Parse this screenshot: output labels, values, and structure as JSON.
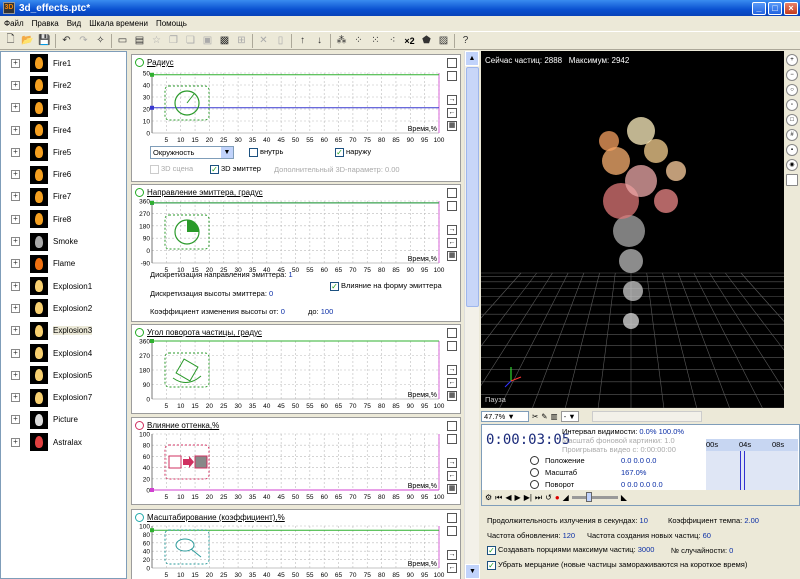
{
  "window": {
    "title": "3d_effects.ptc*"
  },
  "menu": [
    "Файл",
    "Правка",
    "Вид",
    "Шкала времени",
    "Помощь"
  ],
  "layers": [
    {
      "name": "Fire1",
      "icon": "fire-thumbnail-icon"
    },
    {
      "name": "Fire2",
      "icon": "fire-thumbnail-icon"
    },
    {
      "name": "Fire3",
      "icon": "fire-thumbnail-icon"
    },
    {
      "name": "Fire4",
      "icon": "fire-thumbnail-icon"
    },
    {
      "name": "Fire5",
      "icon": "fire-thumbnail-icon"
    },
    {
      "name": "Fire6",
      "icon": "fire-thumbnail-icon"
    },
    {
      "name": "Fire7",
      "icon": "fire-thumbnail-icon"
    },
    {
      "name": "Fire8",
      "icon": "fire-thumbnail-icon"
    },
    {
      "name": "Smoke",
      "icon": "smoke-thumbnail-icon"
    },
    {
      "name": "Flame",
      "icon": "flame-thumbnail-icon"
    },
    {
      "name": "Explosion1",
      "icon": "explosion-thumbnail-icon"
    },
    {
      "name": "Explosion2",
      "icon": "explosion-thumbnail-icon"
    },
    {
      "name": "Explosion3",
      "icon": "explosion-thumbnail-icon"
    },
    {
      "name": "Explosion4",
      "icon": "explosion-thumbnail-icon"
    },
    {
      "name": "Explosion5",
      "icon": "explosion-thumbnail-icon"
    },
    {
      "name": "Explosion7",
      "icon": "explosion-thumbnail-icon"
    },
    {
      "name": "Picture",
      "icon": "picture-thumbnail-icon"
    },
    {
      "name": "Astralax",
      "icon": "astralax-thumbnail-icon"
    }
  ],
  "selected_layer": "Explosion3",
  "xaxis_ticks": [
    "5",
    "10",
    "15",
    "20",
    "25",
    "30",
    "35",
    "40",
    "45",
    "50",
    "55",
    "60",
    "65",
    "70",
    "75",
    "80",
    "85",
    "90",
    "95",
    "100"
  ],
  "xaxis_label": "Время,%",
  "params": {
    "radius": {
      "title": "Радиус",
      "yticks": [
        "50",
        "40",
        "30",
        "20",
        "10",
        "0"
      ],
      "shape_select": "Окружность",
      "inside_label": "внутрь",
      "outside_label": "наружу",
      "scene3d_label": "3D сцена",
      "emitter3d_label": "3D эмиттер",
      "extra3d_label": "Дополнительный 3D-параметр: 0.00"
    },
    "direction": {
      "title": "Направление эмиттера, градус",
      "yticks": [
        "360",
        "270",
        "180",
        "90",
        "0",
        "-90"
      ],
      "discretization_dir": "Дискретизация направления эмиттера:",
      "discretization_dir_value": "1",
      "discretization_height": "Дискретизация высоты эмиттера:",
      "discretization_height_value": "0",
      "shape_influence_label": "Влияние на форму эмиттера",
      "height_coef_label": "Коэффициент изменения высоты от:",
      "height_coef_from": "0",
      "height_coef_to_label": "до:",
      "height_coef_to": "100"
    },
    "rotation": {
      "title": "Угол поворота частицы, градус",
      "yticks": [
        "360",
        "270",
        "180",
        "90",
        "0"
      ]
    },
    "tint": {
      "title": "Влияние оттенка,%",
      "yticks": [
        "100",
        "80",
        "60",
        "40",
        "20",
        "0"
      ]
    },
    "scale": {
      "title": "Масштабирование (коэффициент),%",
      "yticks": [
        "100",
        "80",
        "60",
        "40",
        "20",
        "0"
      ]
    }
  },
  "preview": {
    "particles_label": "Сейчас частиц:",
    "particles_value": "2888",
    "max_label": "Максимум:",
    "max_value": "2942",
    "status": "Пауза"
  },
  "timeline": {
    "zoom": "47.7%",
    "timecode": "0:00:03:05",
    "visibility_label": "Интервал видимости:",
    "visibility_from": "0.0%",
    "visibility_to": "100.0%",
    "bg_scale": "Масштаб фоновой картинки: 1.0",
    "play_video": "Проигрывать видео с: 0:00:00:00",
    "ruler": [
      "00s",
      "04s",
      "08s"
    ],
    "rows": [
      {
        "name": "Положение",
        "value": "0.0   0.0   0.0"
      },
      {
        "name": "Масштаб",
        "value": "167.0%"
      },
      {
        "name": "Поворот",
        "value": "0   0.0   0.0   0.0"
      }
    ]
  },
  "emitter": {
    "duration_label": "Продолжительность излучения в секундах:",
    "duration_value": "10",
    "tempo_label": "Коэффициент темпа:",
    "tempo_value": "2.00",
    "update_label": "Частота обновления:",
    "update_value": "120",
    "creation_label": "Частота создания новых частиц:",
    "creation_value": "60",
    "burst_label": "Создавать порциями максимум частиц:",
    "burst_value": "3000",
    "random_label": "№ случайности:",
    "random_value": "0",
    "flicker_label": "Убрать мерцание (новые частицы замораживаются на короткое время)"
  },
  "colors": {
    "accent": "#2a9a2a",
    "line_blue": "#3838d0",
    "line_green": "#2fb02f",
    "line_magenta": "#d040d0"
  }
}
